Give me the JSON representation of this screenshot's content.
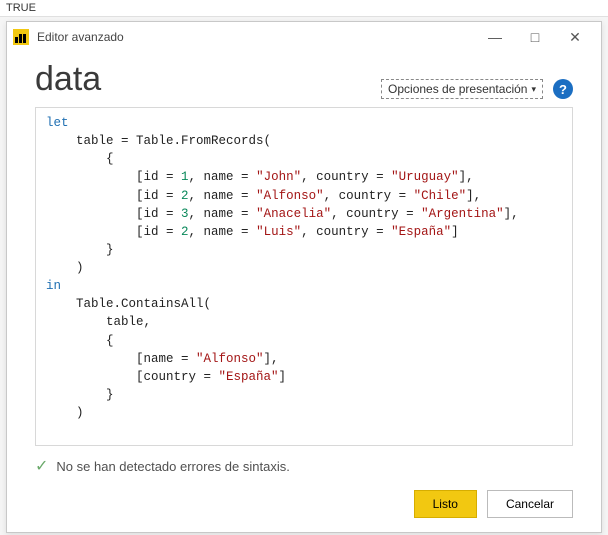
{
  "outer_label": "TRUE",
  "window": {
    "app_title": "Editor avanzado",
    "minimize": "—",
    "maximize": "□",
    "close": "✕"
  },
  "header": {
    "title": "data",
    "options_label": "Opciones de presentación",
    "help_label": "?"
  },
  "code": {
    "tokens": [
      {
        "t": "kw",
        "v": "let"
      },
      {
        "t": "nl"
      },
      {
        "t": "sp",
        "v": "    "
      },
      {
        "t": "pl",
        "v": "table = Table.FromRecords("
      },
      {
        "t": "nl"
      },
      {
        "t": "sp",
        "v": "        "
      },
      {
        "t": "pl",
        "v": "{"
      },
      {
        "t": "nl"
      },
      {
        "t": "sp",
        "v": "            "
      },
      {
        "t": "pl",
        "v": "[id = "
      },
      {
        "t": "num",
        "v": "1"
      },
      {
        "t": "pl",
        "v": ", name = "
      },
      {
        "t": "str",
        "v": "\"John\""
      },
      {
        "t": "pl",
        "v": ", country = "
      },
      {
        "t": "str",
        "v": "\"Uruguay\""
      },
      {
        "t": "pl",
        "v": "],"
      },
      {
        "t": "nl"
      },
      {
        "t": "sp",
        "v": "            "
      },
      {
        "t": "pl",
        "v": "[id = "
      },
      {
        "t": "num",
        "v": "2"
      },
      {
        "t": "pl",
        "v": ", name = "
      },
      {
        "t": "str",
        "v": "\"Alfonso\""
      },
      {
        "t": "pl",
        "v": ", country = "
      },
      {
        "t": "str",
        "v": "\"Chile\""
      },
      {
        "t": "pl",
        "v": "],"
      },
      {
        "t": "nl"
      },
      {
        "t": "sp",
        "v": "            "
      },
      {
        "t": "pl",
        "v": "[id = "
      },
      {
        "t": "num",
        "v": "3"
      },
      {
        "t": "pl",
        "v": ", name = "
      },
      {
        "t": "str",
        "v": "\"Anacelia\""
      },
      {
        "t": "pl",
        "v": ", country = "
      },
      {
        "t": "str",
        "v": "\"Argentina\""
      },
      {
        "t": "pl",
        "v": "],"
      },
      {
        "t": "nl"
      },
      {
        "t": "sp",
        "v": "            "
      },
      {
        "t": "pl",
        "v": "[id = "
      },
      {
        "t": "num",
        "v": "2"
      },
      {
        "t": "pl",
        "v": ", name = "
      },
      {
        "t": "str",
        "v": "\"Luis\""
      },
      {
        "t": "pl",
        "v": ", country = "
      },
      {
        "t": "str",
        "v": "\"España\""
      },
      {
        "t": "pl",
        "v": "]"
      },
      {
        "t": "nl"
      },
      {
        "t": "sp",
        "v": "        "
      },
      {
        "t": "pl",
        "v": "}"
      },
      {
        "t": "nl"
      },
      {
        "t": "sp",
        "v": "    "
      },
      {
        "t": "pl",
        "v": ")"
      },
      {
        "t": "nl"
      },
      {
        "t": "kw",
        "v": "in"
      },
      {
        "t": "nl"
      },
      {
        "t": "sp",
        "v": "    "
      },
      {
        "t": "pl",
        "v": "Table.ContainsAll("
      },
      {
        "t": "nl"
      },
      {
        "t": "sp",
        "v": "        "
      },
      {
        "t": "pl",
        "v": "table,"
      },
      {
        "t": "nl"
      },
      {
        "t": "sp",
        "v": "        "
      },
      {
        "t": "pl",
        "v": "{"
      },
      {
        "t": "nl"
      },
      {
        "t": "sp",
        "v": "            "
      },
      {
        "t": "pl",
        "v": "[name = "
      },
      {
        "t": "str",
        "v": "\"Alfonso\""
      },
      {
        "t": "pl",
        "v": "],"
      },
      {
        "t": "nl"
      },
      {
        "t": "sp",
        "v": "            "
      },
      {
        "t": "pl",
        "v": "[country = "
      },
      {
        "t": "str",
        "v": "\"España\""
      },
      {
        "t": "pl",
        "v": "]"
      },
      {
        "t": "nl"
      },
      {
        "t": "sp",
        "v": "        "
      },
      {
        "t": "pl",
        "v": "}"
      },
      {
        "t": "nl"
      },
      {
        "t": "sp",
        "v": "    "
      },
      {
        "t": "pl",
        "v": ")"
      }
    ]
  },
  "status": {
    "message": "No se han detectado errores de sintaxis."
  },
  "buttons": {
    "done": "Listo",
    "cancel": "Cancelar"
  }
}
